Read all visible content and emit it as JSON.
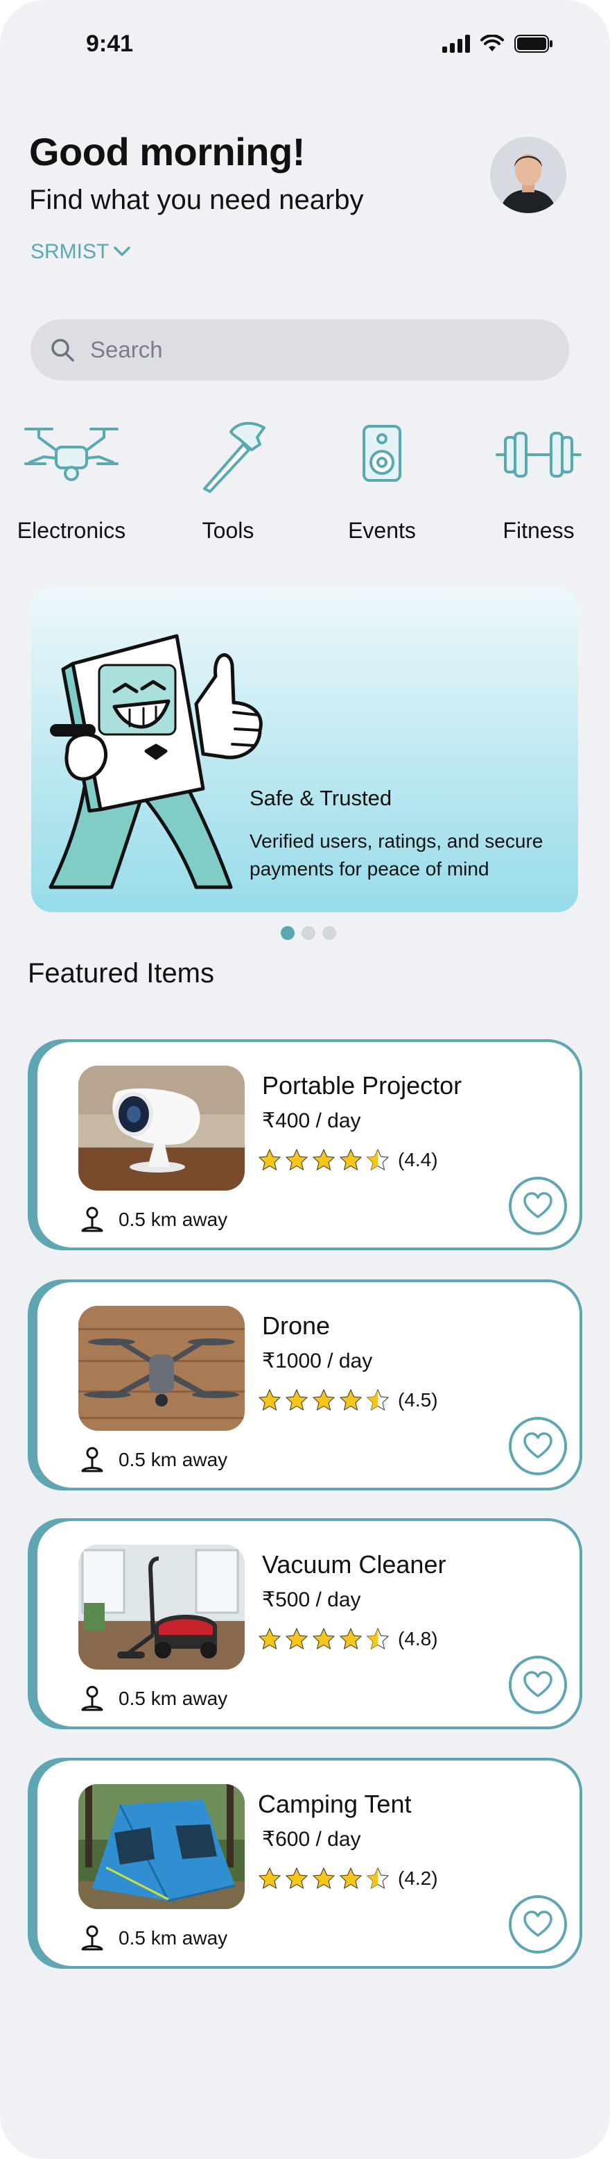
{
  "status": {
    "time": "9:41"
  },
  "header": {
    "greeting": "Good morning!",
    "subtitle": "Find what you need nearby",
    "location": "SRMIST"
  },
  "search": {
    "placeholder": "Search"
  },
  "categories": [
    {
      "label": "Electronics",
      "icon": "drone-icon"
    },
    {
      "label": "Tools",
      "icon": "hammer-icon"
    },
    {
      "label": "Events",
      "icon": "speaker-icon"
    },
    {
      "label": "Fitness",
      "icon": "dumbbell-icon"
    }
  ],
  "banner": {
    "title": "Safe & Trusted",
    "description": "Verified users, ratings, and secure payments for peace of mind",
    "pages": 3,
    "active_page": 1
  },
  "featured": {
    "title": "Featured Items",
    "items": [
      {
        "name": "Portable Projector",
        "price": "₹400 / day",
        "rating": "(4.4)",
        "stars": 4.5,
        "distance": "0.5 km away"
      },
      {
        "name": "Drone",
        "price": "₹1000 / day",
        "rating": "(4.5)",
        "stars": 4.5,
        "distance": "0.5 km away"
      },
      {
        "name": "Vacuum Cleaner",
        "price": "₹500 / day",
        "rating": "(4.8)",
        "stars": 4.5,
        "distance": "0.5 km away"
      },
      {
        "name": "Camping Tent",
        "price": "₹600 / day",
        "rating": "(4.2)",
        "stars": 4.5,
        "distance": "0.5 km away"
      }
    ]
  },
  "colors": {
    "accent": "#5ea7b2",
    "background": "#f0f1f5",
    "star": "#f5c518"
  }
}
